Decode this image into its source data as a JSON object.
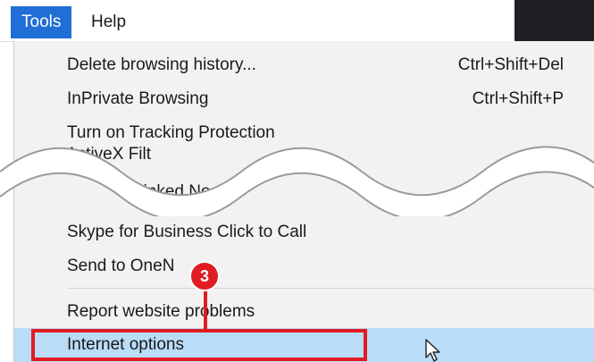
{
  "menubar": {
    "tools_label": "Tools",
    "help_label": "Help"
  },
  "menu": {
    "items": [
      {
        "label": "Delete browsing history...",
        "shortcut": "Ctrl+Shift+Del"
      },
      {
        "label": "InPrivate Browsing",
        "shortcut": "Ctrl+Shift+P"
      },
      {
        "label": "Turn on Tracking Protection",
        "shortcut": ""
      },
      {
        "label": "ActiveX Filt",
        "shortcut": ""
      },
      {
        "label": "Linked No",
        "shortcut": ""
      },
      {
        "label": "Skype for Business Click to Call",
        "shortcut": ""
      },
      {
        "label": "Send to OneN",
        "shortcut": ""
      },
      {
        "label": "Report website problems",
        "shortcut": ""
      },
      {
        "label": "Internet options",
        "shortcut": ""
      }
    ]
  },
  "annotation": {
    "step_number": "3",
    "color": "#e11c23"
  },
  "colors": {
    "menu_highlight": "#1f6fd6",
    "active_item": "#b9dcf7"
  }
}
